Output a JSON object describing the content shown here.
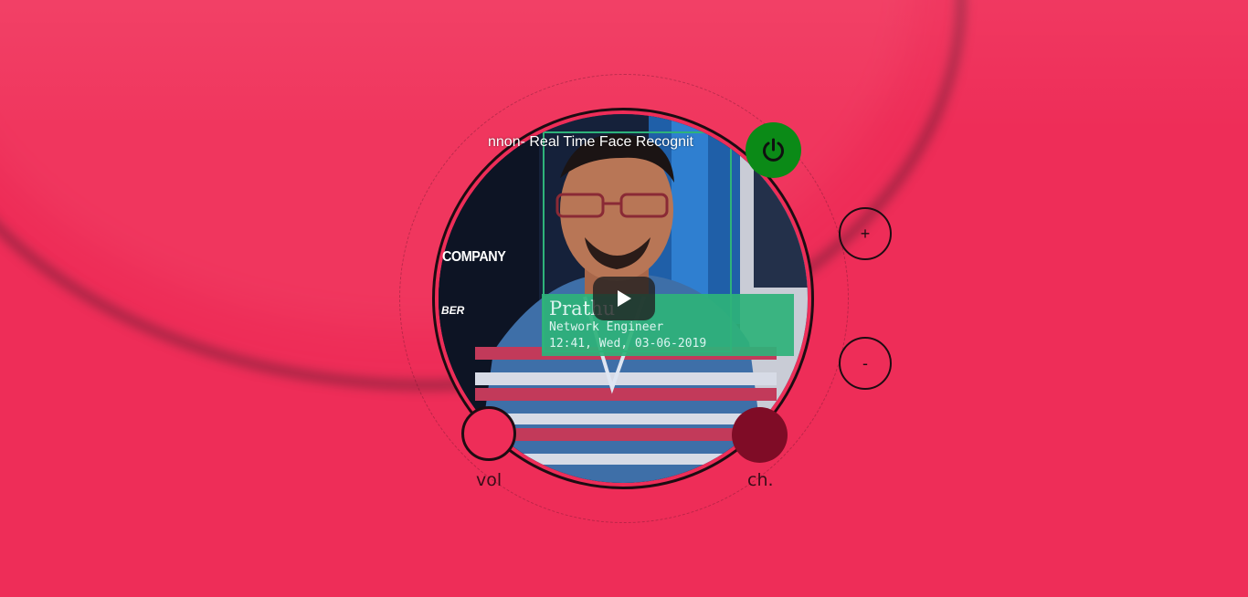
{
  "video": {
    "title": "nnon- Real Time Face Recognit",
    "overlay": {
      "name": "Prathu",
      "role": "Network Engineer",
      "timestamp": "12:41, Wed, 03-06-2019"
    },
    "background_texts": {
      "company": "COMPANY",
      "ber": "BER"
    }
  },
  "controls": {
    "plus_label": "+",
    "minus_label": "-",
    "vol_label": "vol",
    "ch_label": "ch."
  },
  "icons": {
    "power": "power-icon",
    "play": "play-icon"
  },
  "colors": {
    "background": "#ee2d58",
    "power_button": "#0b8a17",
    "channel_knob": "#7f0c26",
    "outline": "#1d0c12",
    "overlay_card": "#2eb37a"
  }
}
